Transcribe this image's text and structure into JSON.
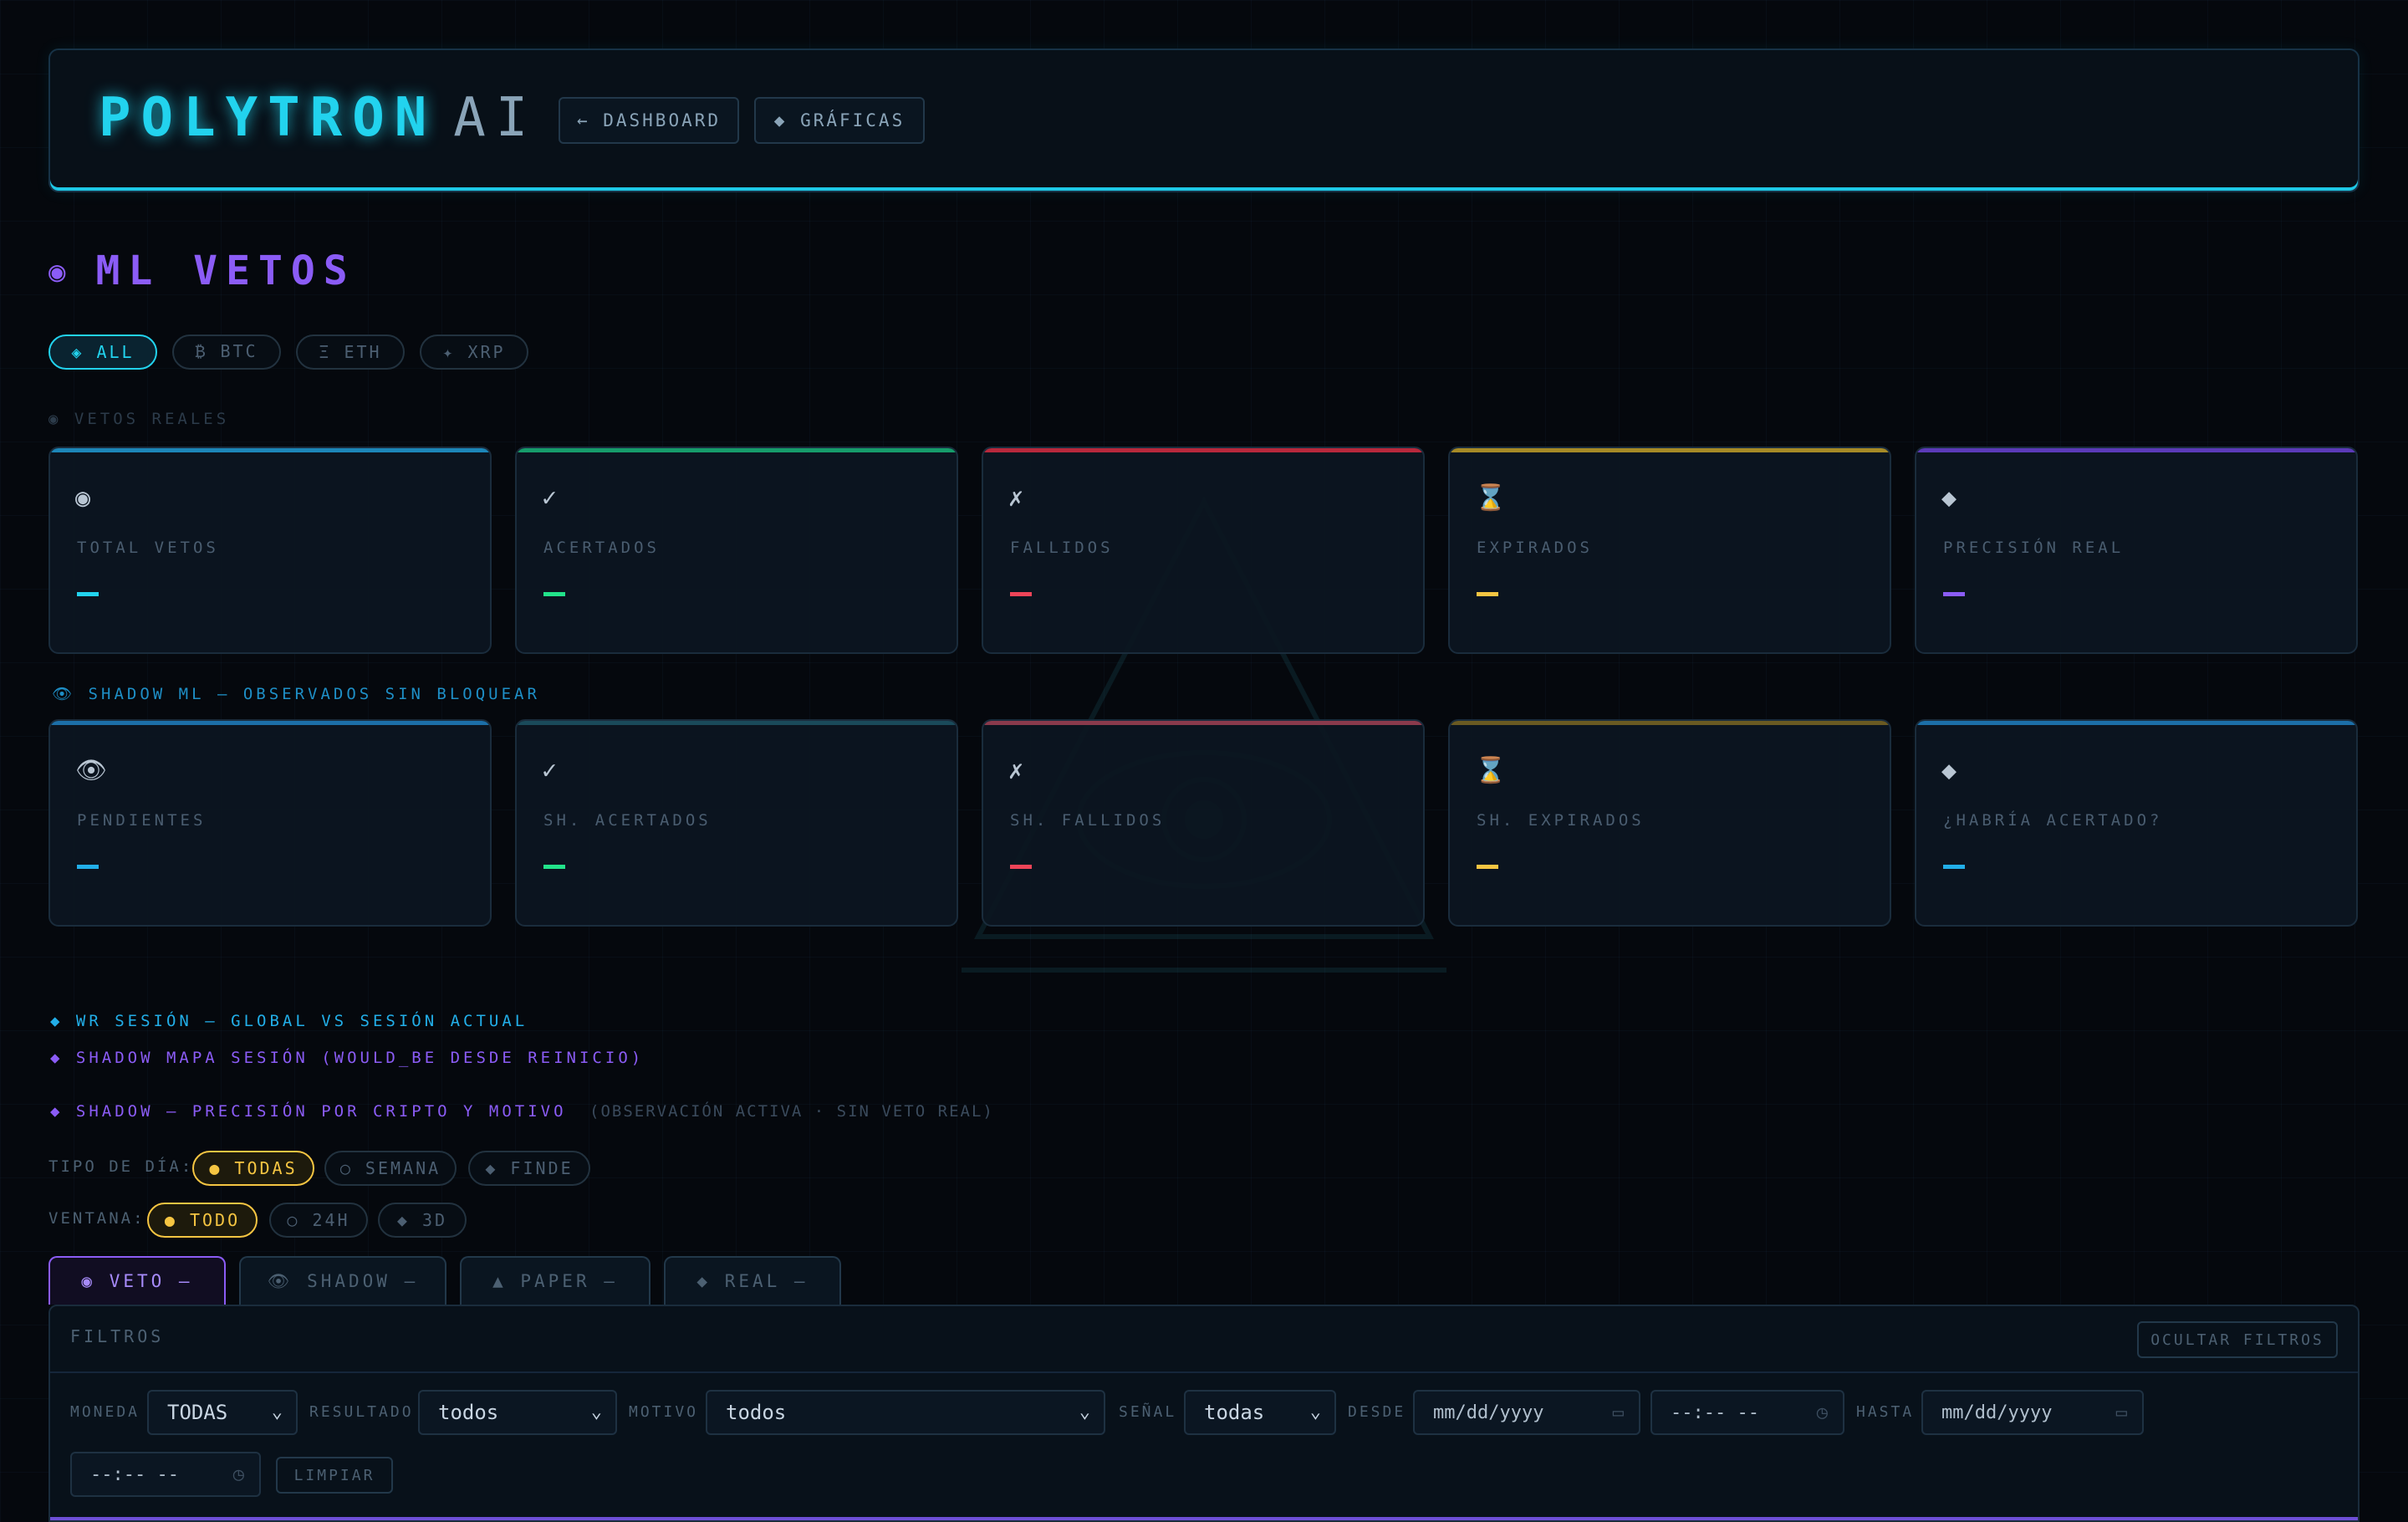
{
  "header": {
    "brand_primary": "POLYTRON",
    "brand_secondary": "AI",
    "nav": [
      {
        "label": "← DASHBOARD"
      },
      {
        "label": "◆ GRÁFICAS"
      }
    ]
  },
  "page": {
    "title_icon": "◉",
    "title": "ML VETOS"
  },
  "coin_filter": [
    {
      "label": "◈ ALL",
      "active": true
    },
    {
      "label": "₿ BTC",
      "active": false
    },
    {
      "label": "Ξ ETH",
      "active": false
    },
    {
      "label": "✦ XRP",
      "active": false
    }
  ],
  "real_section": {
    "label": "◉ VETOS REALES",
    "cards": [
      {
        "icon": "◉",
        "label": "TOTAL VETOS",
        "value": "—",
        "color": "#22d3ee"
      },
      {
        "icon": "✓",
        "label": "ACERTADOS",
        "value": "—",
        "color": "#22e38a"
      },
      {
        "icon": "✗",
        "label": "FALLIDOS",
        "value": "—",
        "color": "#ef4458"
      },
      {
        "icon": "⌛",
        "label": "EXPIRADOS",
        "value": "—",
        "color": "#f5c542"
      },
      {
        "icon": "◆",
        "label": "PRECISIÓN REAL",
        "value": "—",
        "color": "#8b5cf6"
      }
    ]
  },
  "shadow_section": {
    "label": "👁 SHADOW ML — OBSERVADOS SIN BLOQUEAR",
    "cards": [
      {
        "icon": "👁",
        "label": "PENDIENTES",
        "value": "—",
        "color": "#22aee8"
      },
      {
        "icon": "✓",
        "label": "SH. ACERTADOS",
        "value": "—",
        "color": "#22e38a"
      },
      {
        "icon": "✗",
        "label": "SH. FALLIDOS",
        "value": "—",
        "color": "#ef4458"
      },
      {
        "icon": "⌛",
        "label": "SH. EXPIRADOS",
        "value": "—",
        "color": "#f5c542"
      },
      {
        "icon": "◆",
        "label": "¿HABRÍA ACERTADO?",
        "value": "—",
        "color": "#22aee8"
      }
    ]
  },
  "links": {
    "wr_session": "◆ WR SESIÓN — GLOBAL VS SESIÓN ACTUAL",
    "shadow_map": "◆ SHADOW MAPA SESIÓN (WOULD_BE DESDE REINICIO)",
    "shadow_precision": "◆ SHADOW — PRECISIÓN POR CRIPTO Y MOTIVO",
    "shadow_precision_note": "(OBSERVACIÓN ACTIVA · SIN VETO REAL)"
  },
  "day_type": {
    "label": "TIPO DE DÍA:",
    "options": [
      {
        "label": "● TODAS",
        "active": true
      },
      {
        "label": "○ SEMANA",
        "active": false
      },
      {
        "label": "◆ FINDE",
        "active": false
      }
    ]
  },
  "window": {
    "label": "VENTANA:",
    "options": [
      {
        "label": "● TODO",
        "active": true
      },
      {
        "label": "○ 24H",
        "active": false
      },
      {
        "label": "◆ 3D",
        "active": false
      }
    ]
  },
  "tabs": [
    {
      "label": "◉ VETO  —",
      "active": true
    },
    {
      "label": "👁 SHADOW  —",
      "active": false
    },
    {
      "label": "▲ PAPER  —",
      "active": false
    },
    {
      "label": "◆ REAL  —",
      "active": false
    }
  ],
  "filters": {
    "title": "FILTROS",
    "hide_label": "OCULTAR FILTROS",
    "moneda_label": "MONEDA",
    "moneda_value": "TODAS",
    "resultado_label": "RESULTADO",
    "resultado_value": "todos",
    "motivo_label": "MOTIVO",
    "motivo_value": "todos",
    "senal_label": "SEÑAL",
    "senal_value": "todas",
    "desde_label": "DESDE",
    "desde_date": "mm/dd/yyyy",
    "desde_time": "--:-- --",
    "hasta_label": "HASTA",
    "hasta_date": "mm/dd/yyyy",
    "hasta_time": "--:-- --",
    "clear_label": "LIMPIAR"
  }
}
